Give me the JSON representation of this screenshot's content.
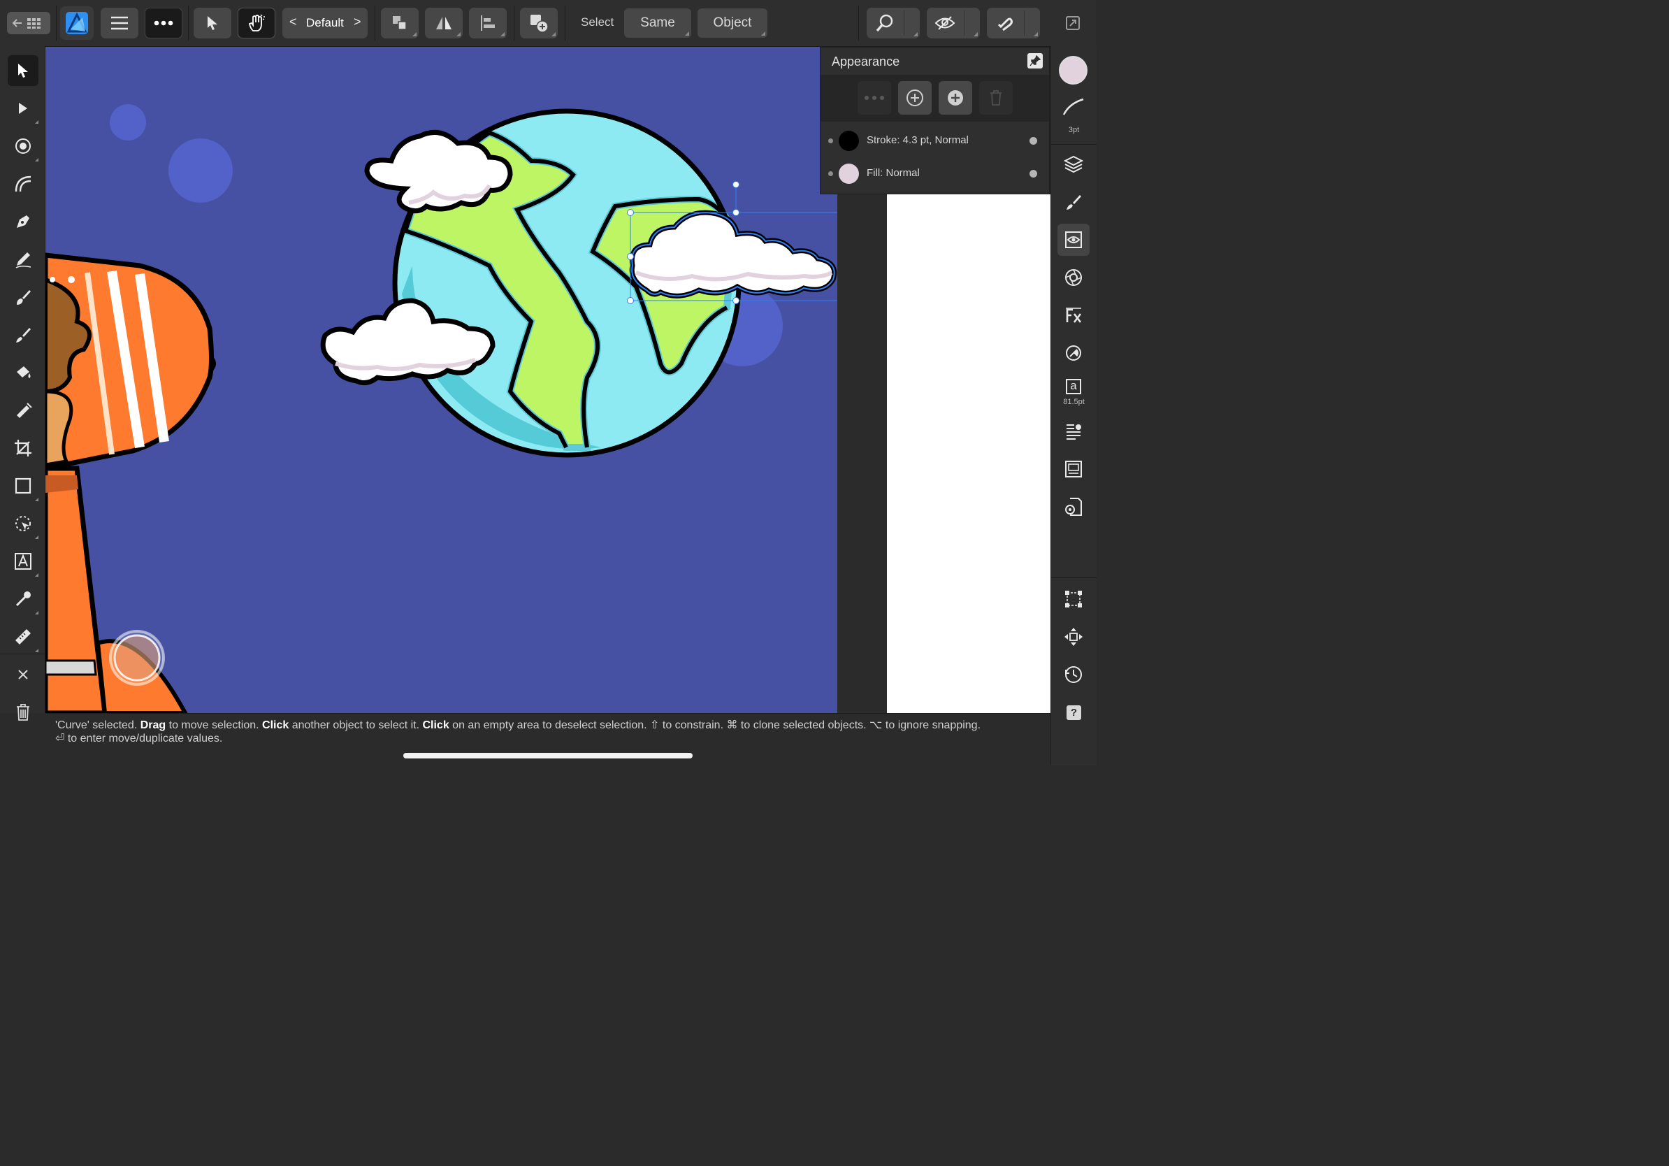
{
  "app": {
    "name": "Affinity Designer"
  },
  "toolbar": {
    "style_selector": {
      "prev": "<",
      "label": "Default",
      "next": ">"
    },
    "select_label": "Select",
    "same_button": "Same",
    "object_button": "Object"
  },
  "appearance_panel": {
    "title": "Appearance",
    "rows": [
      {
        "label": "Stroke: 4.3 pt, Normal",
        "swatch": "#000000"
      },
      {
        "label": "Fill: Normal",
        "swatch": "#e2d2de"
      }
    ]
  },
  "studio": {
    "fill_swatch": "#e2d2de",
    "stroke_width_label": "3pt",
    "text_size_label": "81.5pt",
    "text_icon_glyph": "a",
    "help_glyph": "?"
  },
  "status": {
    "line1": [
      {
        "t": "'Curve' selected. ",
        "b": false
      },
      {
        "t": "Drag",
        "b": true
      },
      {
        "t": " to move selection. ",
        "b": false
      },
      {
        "t": "Click",
        "b": true
      },
      {
        "t": " another object to select it. ",
        "b": false
      },
      {
        "t": "Click",
        "b": true
      },
      {
        "t": " on an empty area to deselect selection. ⇧ to constrain. ⌘ to clone selected objects. ⌥ to ignore snapping.",
        "b": false
      }
    ],
    "line2": "⏎ to enter move/duplicate values."
  },
  "colors": {
    "canvas_bg": "#4651a3",
    "ocean": "#8eeaf2",
    "land": "#bef565",
    "cloud": "#ffffff",
    "cloud_shade": "#e2d2de",
    "rocket": "#fe7a2f",
    "selection": "#2f7ff5"
  },
  "icons": {
    "left_tools": [
      "move-tool-icon",
      "node-tool-icon",
      "corner-tool-icon",
      "point-transform-icon",
      "pen-tool-icon",
      "pencil-tool-icon",
      "vector-brush-icon",
      "paint-brush-icon",
      "fill-tool-icon",
      "transparency-tool-icon",
      "crop-tool-icon",
      "rectangle-tool-icon",
      "vector-crop-icon",
      "artistic-text-icon",
      "color-picker-icon",
      "measure-tool-icon"
    ],
    "right_studio": [
      "layers-icon",
      "brushes-icon",
      "appearance-icon",
      "styles-icon",
      "fx-icon",
      "color-wheel-icon",
      "text-icon",
      "text-styles-icon",
      "navigator-icon",
      "document-settings-icon",
      "transform-icon",
      "move-icon",
      "history-icon",
      "help-icon"
    ]
  }
}
